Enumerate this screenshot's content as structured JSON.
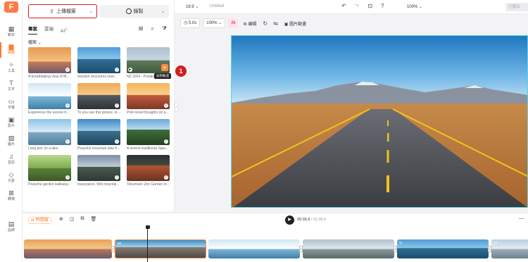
{
  "rail": {
    "logo": "F",
    "items": [
      {
        "label": "範本",
        "icon": "template-icon"
      },
      {
        "label": "媒體",
        "icon": "media-icon",
        "active": true
      },
      {
        "label": "工具",
        "icon": "tools-icon"
      },
      {
        "label": "文字",
        "icon": "text-icon"
      },
      {
        "label": "字幕",
        "icon": "subtitle-icon"
      },
      {
        "label": "影片",
        "icon": "video-icon"
      },
      {
        "label": "圖片",
        "icon": "image-icon"
      },
      {
        "label": "音訊",
        "icon": "audio-icon"
      },
      {
        "label": "元素",
        "icon": "elements-icon"
      },
      {
        "label": "轉場",
        "icon": "transition-icon"
      },
      {
        "label": "品牌",
        "icon": "brand-icon"
      }
    ]
  },
  "panel": {
    "upload_label": "上傳檔案",
    "record_label": "錄製",
    "tabs": [
      {
        "label": "專案",
        "active": true
      },
      {
        "label": "雲端"
      },
      {
        "label": "AI",
        "sup": "※"
      }
    ],
    "files_label": "檔案",
    "files": [
      {
        "caption": "A breathtaking view of M...",
        "bg": "linear-gradient(#e89a55,#f2c27a 55%,#c9785a 56%,#6b5a6a)"
      },
      {
        "caption": "wooden structures near...",
        "bg": "linear-gradient(#4f9dd6,#8cc7ea 45%,#2f6f95 46%,#1d4d6c)"
      },
      {
        "caption": "NZ 2024 - Punakaiki",
        "bg": "linear-gradient(#aebfcf,#c8d6df 50%,#5f7a5a 51%,#3e5a3e)"
      },
      {
        "caption": "Experience the serene be...",
        "bg": "linear-gradient(#cfe6f3,#ffffff 50%,#7fb6d6 51%,#3f7fa8)"
      },
      {
        "caption": "To you use this picture, in...",
        "bg": "linear-gradient(#f0a85a,#f6c987 45%,#555b63 46%,#2e3136)"
      },
      {
        "caption": "Pink toned thoughts on a...",
        "bg": "linear-gradient(#f6b35a,#f7d28c 45%,#c45a3a 46%,#7a3a2a)"
      },
      {
        "caption": "Long pier on a lake",
        "bg": "linear-gradient(#8ec3e6,#dceef8 50%,#7fa9c4 51%,#4f7f9c)"
      },
      {
        "caption": "Peaceful mountain lake fr...",
        "bg": "linear-gradient(#3f88c7,#9dcbe8 45%,#3a6f8c 46%,#1e4660)"
      },
      {
        "caption": "A serene traditional Japa...",
        "bg": "linear-gradient(#6aa8d8,#b9d9ee 40%,#3f6e3a 41%,#24421f)"
      },
      {
        "caption": "Peaceful garden walkway...",
        "bg": "linear-gradient(#b9d88a,#7fae4f 50%,#5a7f38 51%,#3d5a25)"
      },
      {
        "caption": "traveyukon, Wet mountai...",
        "bg": "linear-gradient(#7a8ea3,#c1cdd8 45%,#4a5a4f 46%,#2e3a32)"
      },
      {
        "caption": "Tokumeen Zen Garden in...",
        "bg": "linear-gradient(#2e2e3a,#3f4a3a 40%,#b4552f 41%,#6a3324)"
      }
    ],
    "add_tip": "加到軌道",
    "badge": "1"
  },
  "topbar": {
    "ratio": "16:9",
    "title": "Untitled",
    "zoom": "100%",
    "export": "已匯出"
  },
  "toolbar": {
    "duration": "5.0s",
    "scale": "100%",
    "ai": "AI",
    "edit": "编辑",
    "pip": "圖片動畫"
  },
  "timeline": {
    "button": "時間線",
    "time_current": "00:36.9",
    "time_total": "/ 01:00.0",
    "clips": [
      {
        "num": "",
        "bg": "linear-gradient(#e9a25a,#f4c98a 50%,#b8745a 51%,#6a5a6a)"
      },
      {
        "num": "08",
        "bg": "linear-gradient(#3f8ec9,#a5d3ee 40%,#8a7a6a 41%,#4a4a4e)",
        "selected": true
      },
      {
        "num": "",
        "bg": "linear-gradient(#cfe6f3,#ffffff 50%,#7fb6d6 51%,#3f7fa8)"
      },
      {
        "num": "",
        "bg": "linear-gradient(#aebfcf,#e3eaee 50%,#8a9a9a 51%,#5a6a6a)"
      },
      {
        "num": "11",
        "bg": "linear-gradient(#4f9dd6,#8cc7ea 45%,#2f6f95 46%,#1d4d6c)"
      },
      {
        "num": "12",
        "bg": "linear-gradient(#b9cfe0,#e6eef4 50%,#9aaebb 51%,#6e8290)"
      }
    ]
  }
}
